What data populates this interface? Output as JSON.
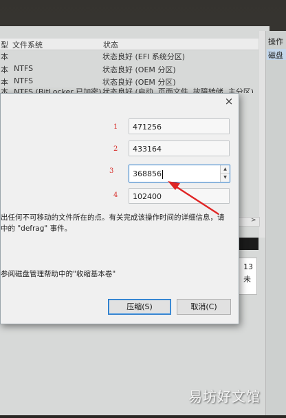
{
  "table": {
    "headers": [
      "型",
      "文件系统",
      "状态"
    ],
    "rows": [
      {
        "type": "本",
        "fs": "",
        "status": "状态良好 (EFI 系统分区)"
      },
      {
        "type": "本",
        "fs": "NTFS",
        "status": "状态良好 (OEM 分区)"
      },
      {
        "type": "本",
        "fs": "NTFS",
        "status": "状态良好 (OEM 分区)"
      },
      {
        "type": "本",
        "fs": "NTFS (BitLocker 已加密)",
        "status": "状态良好 (启动, 页面文件, 故障转储, 主分区)"
      }
    ]
  },
  "right_pane": {
    "header": "操作",
    "selected": "磁盘"
  },
  "disk_panel": {
    "line1": "13",
    "line2": "未"
  },
  "dialog": {
    "close": "×",
    "fields": [
      {
        "annotation": "1",
        "value": "471256"
      },
      {
        "annotation": "2",
        "value": "433164"
      },
      {
        "annotation": "3",
        "value": "368856"
      },
      {
        "annotation": "4",
        "value": "102400"
      }
    ],
    "desc_line1": "出任何不可移动的文件所在的点。有关完成该操作时间的详细信息，请",
    "desc_line2": "中的 \"defrag\" 事件。",
    "help_text": "参阅磁盘管理帮助中的\"收缩基本卷\"",
    "shrink_button": "压缩(S)",
    "cancel_button": "取消(C)"
  },
  "watermark": "易坊好文馆",
  "colors": {
    "annotation_red": "#d8322e",
    "arrow_red": "#e02424",
    "focus_blue": "#1f75c9"
  }
}
